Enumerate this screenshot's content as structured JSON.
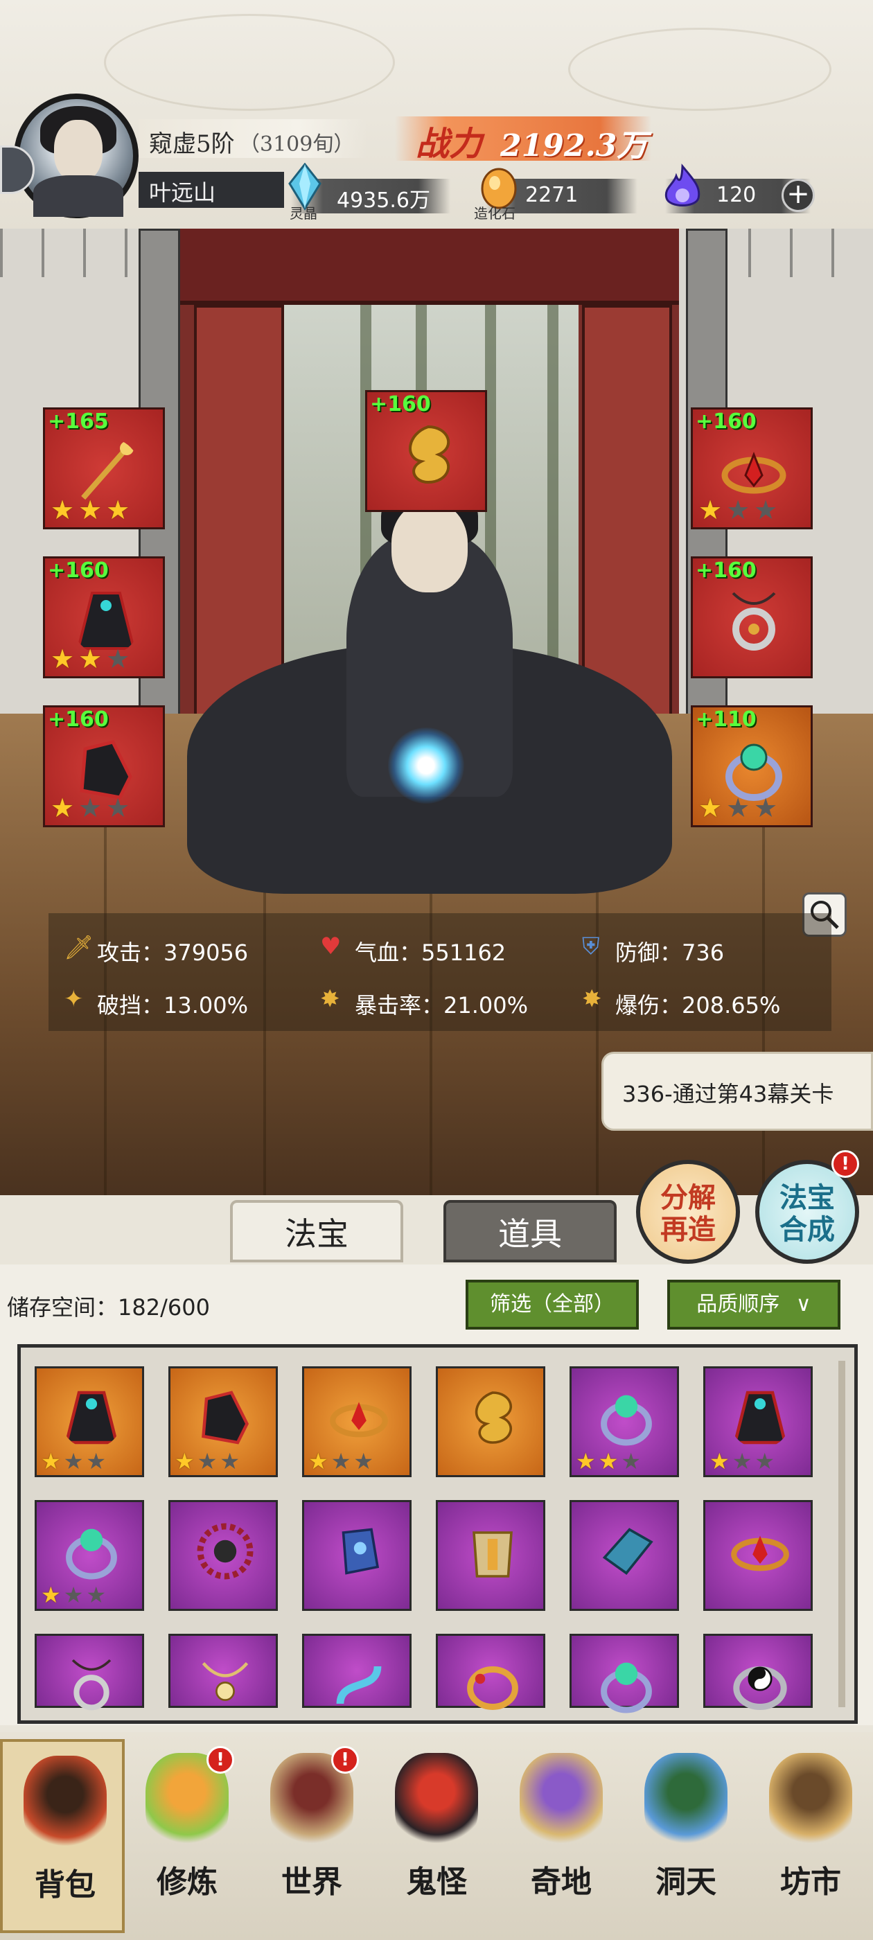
{
  "player": {
    "realm": "窥虚5阶",
    "realm_sub": "（3109旬）",
    "name": "叶远山",
    "power_label": "战力",
    "power_value": "2192.3万"
  },
  "resources": [
    {
      "icon": "spirit-crystal-icon",
      "value": "4935.6万",
      "caption": "灵晶"
    },
    {
      "icon": "creation-stone-icon",
      "value": "2271",
      "caption": "造化石"
    },
    {
      "icon": "soul-fire-icon",
      "value": "120",
      "caption": ""
    }
  ],
  "equipment": {
    "left": [
      {
        "level": "+165",
        "stars": 3,
        "icon": "staff-icon"
      },
      {
        "level": "+160",
        "stars": 2,
        "icon": "robe-icon"
      },
      {
        "level": "+160",
        "stars": 1,
        "icon": "boots-icon"
      }
    ],
    "top": {
      "level": "+160",
      "stars": 0,
      "icon": "golden-cloud-icon"
    },
    "right": [
      {
        "level": "+160",
        "stars": 1,
        "icon": "crown-icon"
      },
      {
        "level": "+160",
        "stars": 0,
        "icon": "pendant-icon"
      },
      {
        "level": "+110",
        "stars": 1,
        "icon": "ring-icon"
      }
    ]
  },
  "stats": {
    "attack": "攻击：379056",
    "hp": "气血：551162",
    "defense": "防御：736",
    "break": "破挡：13.00%",
    "crit_rate": "暴击率：21.00%",
    "crit_dmg": "爆伤：208.65%"
  },
  "quest": "336-通过第43幕关卡",
  "actions": {
    "decompose": "分解再造",
    "synthesize": "法宝合成",
    "synthesize_badge": "!"
  },
  "tabs": {
    "treasure": "法宝",
    "items": "道具"
  },
  "inventory": {
    "storage": "储存空间：182/600",
    "filter": "筛选（全部）",
    "sort": "品质顺序",
    "items": [
      {
        "quality": "orange",
        "icon": "robe-icon",
        "stars": 1
      },
      {
        "quality": "orange",
        "icon": "boots-icon",
        "stars": 1
      },
      {
        "quality": "orange",
        "icon": "crown-icon",
        "stars": 1
      },
      {
        "quality": "orange",
        "icon": "golden-cloud-icon",
        "stars": 0
      },
      {
        "quality": "purple",
        "icon": "ring-icon",
        "stars": 2
      },
      {
        "quality": "purple",
        "icon": "robe-icon",
        "stars": 1
      },
      {
        "quality": "purple",
        "icon": "ring-icon",
        "stars": 1
      },
      {
        "quality": "purple",
        "icon": "wheel-icon",
        "stars": 0
      },
      {
        "quality": "purple",
        "icon": "gauntlet-icon",
        "stars": 0
      },
      {
        "quality": "purple",
        "icon": "armor-icon",
        "stars": 0
      },
      {
        "quality": "purple",
        "icon": "sleeve-icon",
        "stars": 0
      },
      {
        "quality": "purple",
        "icon": "crown-icon",
        "stars": 0
      },
      {
        "quality": "purple",
        "icon": "pendant-icon",
        "stars": 0
      },
      {
        "quality": "purple",
        "icon": "necklace-icon",
        "stars": 0
      },
      {
        "quality": "purple",
        "icon": "serpent-icon",
        "stars": 0
      },
      {
        "quality": "purple",
        "icon": "bracelet-icon",
        "stars": 0
      },
      {
        "quality": "purple",
        "icon": "ring-icon",
        "stars": 0
      },
      {
        "quality": "purple",
        "icon": "yin-yang-ring-icon",
        "stars": 0
      }
    ]
  },
  "nav": [
    {
      "label": "背包",
      "icon": "bag-icon",
      "badge": false,
      "active": true
    },
    {
      "label": "修炼",
      "icon": "lotus-icon",
      "badge": true
    },
    {
      "label": "世界",
      "icon": "scroll-icon",
      "badge": true
    },
    {
      "label": "鬼怪",
      "icon": "demon-egg-icon",
      "badge": false
    },
    {
      "label": "奇地",
      "icon": "mountain-icon",
      "badge": false
    },
    {
      "label": "洞天",
      "icon": "portal-icon",
      "badge": false
    },
    {
      "label": "坊市",
      "icon": "market-icon",
      "badge": false
    }
  ],
  "nav_badge": "!",
  "colors": {
    "orange_quality": "#e08a2c",
    "purple_quality": "#a13fb4",
    "red_slot": "#c2302c",
    "level_green": "#58ff3d",
    "accent": "#5f8f2e"
  }
}
